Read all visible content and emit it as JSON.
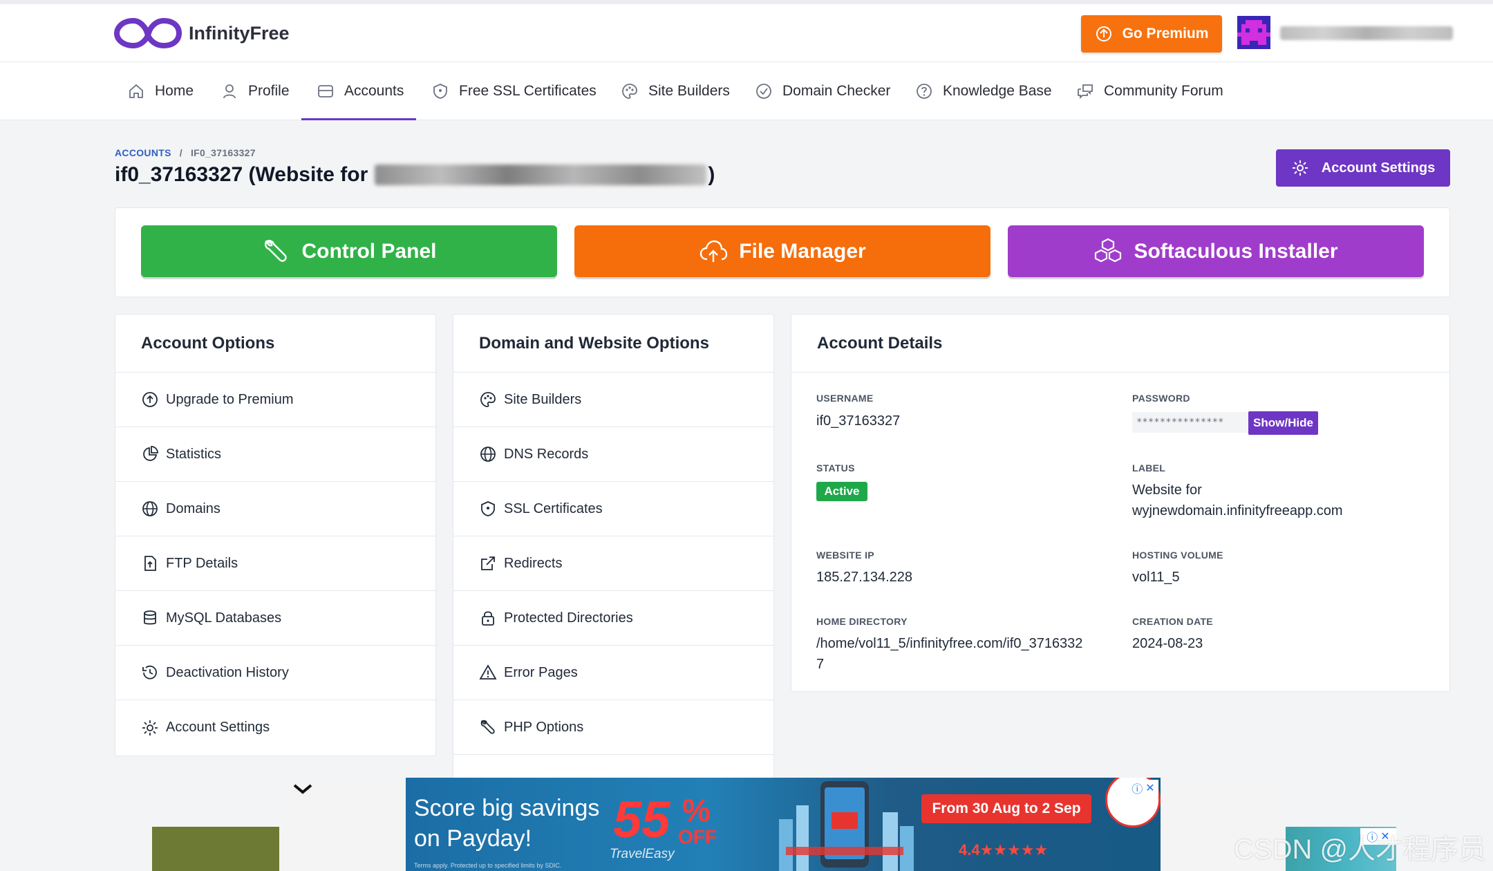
{
  "header": {
    "brand": "InfinityFree",
    "premium_label": "Go Premium"
  },
  "nav": {
    "items": [
      {
        "label": "Home",
        "icon": "home-icon"
      },
      {
        "label": "Profile",
        "icon": "user-icon"
      },
      {
        "label": "Accounts",
        "icon": "accounts-icon",
        "active": true
      },
      {
        "label": "Free SSL Certificates",
        "icon": "shield-icon"
      },
      {
        "label": "Site Builders",
        "icon": "palette-icon"
      },
      {
        "label": "Domain Checker",
        "icon": "check-circle-icon"
      },
      {
        "label": "Knowledge Base",
        "icon": "question-icon"
      },
      {
        "label": "Community Forum",
        "icon": "chat-icon"
      }
    ]
  },
  "breadcrumb": {
    "parent": "ACCOUNTS",
    "separator": "/",
    "current": "IF0_37163327"
  },
  "page": {
    "title": "if0_37163327 (Website for",
    "title_suffix": ")",
    "settings_label": "Account Settings"
  },
  "actions": {
    "control_panel": "Control Panel",
    "file_manager": "File Manager",
    "softaculous": "Softaculous Installer"
  },
  "account_options": {
    "title": "Account Options",
    "items": [
      {
        "label": "Upgrade to Premium",
        "icon": "upgrade-icon"
      },
      {
        "label": "Statistics",
        "icon": "pie-chart-icon"
      },
      {
        "label": "Domains",
        "icon": "globe-icon"
      },
      {
        "label": "FTP Details",
        "icon": "file-upload-icon"
      },
      {
        "label": "MySQL Databases",
        "icon": "database-icon"
      },
      {
        "label": "Deactivation History",
        "icon": "history-icon"
      },
      {
        "label": "Account Settings",
        "icon": "gear-icon"
      }
    ]
  },
  "domain_options": {
    "title": "Domain and Website Options",
    "items": [
      {
        "label": "Site Builders",
        "icon": "palette-icon"
      },
      {
        "label": "DNS Records",
        "icon": "globe-icon"
      },
      {
        "label": "SSL Certificates",
        "icon": "shield-icon"
      },
      {
        "label": "Redirects",
        "icon": "external-link-icon"
      },
      {
        "label": "Protected Directories",
        "icon": "lock-icon"
      },
      {
        "label": "Error Pages",
        "icon": "warning-icon"
      },
      {
        "label": "PHP Options",
        "icon": "wrench-icon"
      }
    ]
  },
  "account_details": {
    "title": "Account Details",
    "username_label": "USERNAME",
    "username": "if0_37163327",
    "password_label": "PASSWORD",
    "password_mask": "***************",
    "show_hide": "Show/Hide",
    "status_label": "STATUS",
    "status": "Active",
    "label_label": "LABEL",
    "label_line1": "Website for",
    "label_line2": "wyjnewdomain.infinityfreeapp.com",
    "ip_label": "WEBSITE IP",
    "ip": "185.27.134.228",
    "volume_label": "HOSTING VOLUME",
    "volume": "vol11_5",
    "home_label": "HOME DIRECTORY",
    "home_line1": "/home/vol11_5/infinityfree.com/if0_3716332",
    "home_line2": "7",
    "created_label": "CREATION DATE",
    "created": "2024-08-23"
  },
  "ad": {
    "line1": "Score big savings",
    "line2": "on Payday!",
    "percent": "55",
    "percent_sign": "%",
    "off": "OFF",
    "brand": "TravelEasy",
    "dates": "From 30 Aug to 2 Sep",
    "rating": "4.4★★★★★",
    "fine_print": "Terms apply. Protected up to specified limits by SDIC."
  },
  "watermark": "CSDN @人才程序员",
  "colors": {
    "brand_purple": "#6e36c4",
    "orange": "#f7720f",
    "green": "#31b249",
    "softaculous": "#a03ccb"
  }
}
